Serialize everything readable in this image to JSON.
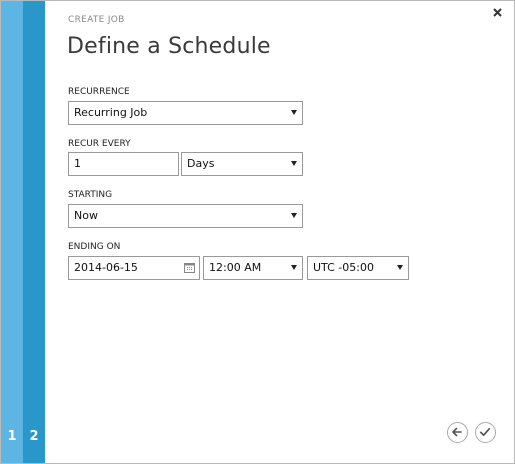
{
  "wizard": {
    "eyebrow": "CREATE JOB",
    "title": "Define a Schedule",
    "steps": [
      "1",
      "2"
    ]
  },
  "form": {
    "recurrence": {
      "label": "RECURRENCE",
      "value": "Recurring Job"
    },
    "recur_every": {
      "label": "RECUR EVERY",
      "count": "1",
      "unit": "Days"
    },
    "starting": {
      "label": "STARTING",
      "value": "Now"
    },
    "ending_on": {
      "label": "ENDING ON",
      "date": "2014-06-15",
      "time": "12:00 AM",
      "timezone": "UTC -05:00"
    }
  },
  "icons": {
    "close": "close-icon",
    "calendar": "calendar-icon",
    "back": "arrow-left-icon",
    "confirm": "checkmark-icon"
  },
  "colors": {
    "rail_outer": "#5cb5e2",
    "rail_inner": "#2a97cb"
  }
}
